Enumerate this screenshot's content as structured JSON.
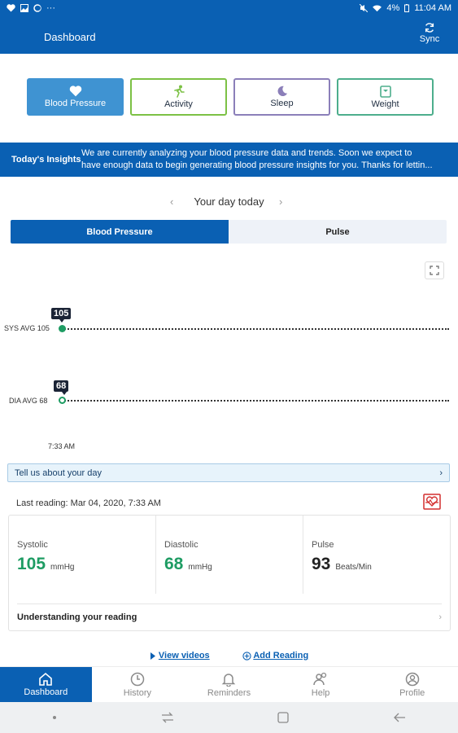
{
  "statusbar": {
    "battery": "4%",
    "time": "11:04 AM"
  },
  "appbar": {
    "title": "Dashboard",
    "sync_label": "Sync"
  },
  "categories": [
    {
      "label": "Blood Pressure",
      "icon": "heart-icon",
      "selected": true
    },
    {
      "label": "Activity",
      "icon": "runner-icon"
    },
    {
      "label": "Sleep",
      "icon": "moon-icon"
    },
    {
      "label": "Weight",
      "icon": "scale-icon"
    }
  ],
  "insights": {
    "label": "Today's Insights",
    "line1": "We are currently analyzing your blood pressure data and trends. Soon we expect to",
    "line2": "have enough data to begin generating blood pressure insights for you. Thanks for lettin..."
  },
  "daynav": {
    "title": "Your day today",
    "prev": "‹",
    "next": "›"
  },
  "tabs": {
    "bp": "Blood Pressure",
    "pulse": "Pulse"
  },
  "chart": {
    "sys_label": "SYS AVG 105",
    "sys_value": "105",
    "dia_label": "DIA AVG 68",
    "dia_value": "68",
    "time_label": "7:33 AM"
  },
  "tellus": {
    "label": "Tell us about your day",
    "chevron": "›"
  },
  "last_reading": "Last reading: Mar 04, 2020, 7:33 AM",
  "readings": {
    "systolic": {
      "label": "Systolic",
      "value": "105",
      "unit": "mmHg"
    },
    "diastolic": {
      "label": "Diastolic",
      "value": "68",
      "unit": "mmHg"
    },
    "pulse": {
      "label": "Pulse",
      "value": "93",
      "unit": "Beats/Min"
    },
    "understanding": "Understanding your reading",
    "chevron": "›"
  },
  "links": {
    "videos": "View videos",
    "add": "Add Reading"
  },
  "bottomnav": {
    "dashboard": "Dashboard",
    "history": "History",
    "reminders": "Reminders",
    "help": "Help",
    "profile": "Profile"
  },
  "colors": {
    "primary": "#0a60b3",
    "accent_green": "#1e9c63",
    "bp_button": "#3f93d2"
  }
}
